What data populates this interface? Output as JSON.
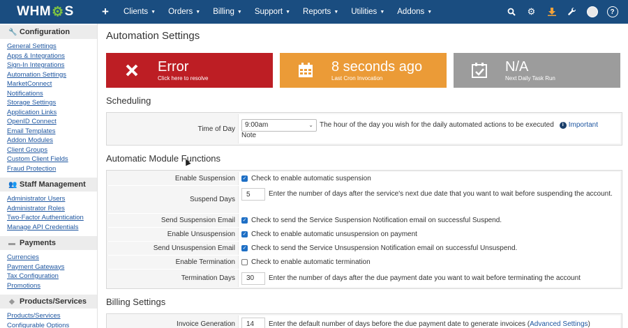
{
  "logo": {
    "left": "WHM",
    "gear": "⚙",
    "right": "S"
  },
  "nav": {
    "items": [
      {
        "label": "Clients"
      },
      {
        "label": "Orders"
      },
      {
        "label": "Billing"
      },
      {
        "label": "Support"
      },
      {
        "label": "Reports"
      },
      {
        "label": "Utilities"
      },
      {
        "label": "Addons"
      }
    ],
    "icons": [
      "search-icon",
      "gears-icon",
      "download-icon",
      "wrench-icon",
      "avatar",
      "help-icon"
    ]
  },
  "sidebar": {
    "sections": [
      {
        "title": "Configuration",
        "icon": "wrench-icon",
        "links": [
          "General Settings",
          "Apps & Integrations",
          "Sign-In Integrations",
          "Automation Settings",
          "MarketConnect",
          "Notifications",
          "Storage Settings",
          "Application Links",
          "OpenID Connect",
          "Email Templates",
          "Addon Modules",
          "Client Groups",
          "Custom Client Fields",
          "Fraud Protection"
        ]
      },
      {
        "title": "Staff Management",
        "icon": "users-icon",
        "links": [
          "Administrator Users",
          "Administrator Roles",
          "Two-Factor Authentication",
          "Manage API Credentials"
        ]
      },
      {
        "title": "Payments",
        "icon": "card-icon",
        "links": [
          "Currencies",
          "Payment Gateways",
          "Tax Configuration",
          "Promotions"
        ]
      },
      {
        "title": "Products/Services",
        "icon": "cube-icon",
        "links": [
          "Products/Services",
          "Configurable Options"
        ]
      }
    ]
  },
  "page": {
    "title": "Automation Settings"
  },
  "stats": [
    {
      "big": "Error",
      "small": "Click here to resolve",
      "icon": "x-icon",
      "color": "#bd1e24"
    },
    {
      "big": "8 seconds ago",
      "small": "Last Cron Invocation",
      "icon": "calendar-icon",
      "color": "#eb9b37"
    },
    {
      "big": "N/A",
      "small": "Next Daily Task Run",
      "icon": "calendar-check-icon",
      "color": "#9c9c9c"
    }
  ],
  "scheduling": {
    "title": "Scheduling",
    "time_label": "Time of Day",
    "time_value": "9:00am",
    "time_desc": "The hour of the day you wish for the daily automated actions to be executed",
    "important": "Important",
    "note": "Note"
  },
  "modules": {
    "title": "Automatic Module Functions",
    "rows": {
      "enable_suspension": {
        "label": "Enable Suspension",
        "checked": true,
        "text": "Check to enable automatic suspension"
      },
      "suspend_days": {
        "label": "Suspend Days",
        "value": "5",
        "text": "Enter the number of days after the service's next due date that you want to wait before suspending the account."
      },
      "send_suspension": {
        "label": "Send Suspension Email",
        "checked": true,
        "text": "Check to send the Service Suspension Notification email on successful Suspend."
      },
      "enable_unsuspension": {
        "label": "Enable Unsuspension",
        "checked": true,
        "text": "Check to enable automatic unsuspension on payment"
      },
      "send_unsuspension": {
        "label": "Send Unsuspension Email",
        "checked": true,
        "text": "Check to send the Service Unsuspension Notification email on successful Unsuspend."
      },
      "enable_termination": {
        "label": "Enable Termination",
        "checked": false,
        "text": "Check to enable automatic termination"
      },
      "termination_days": {
        "label": "Termination Days",
        "value": "30",
        "text": "Enter the number of days after the due payment date you want to wait before terminating the account"
      }
    }
  },
  "billing": {
    "title": "Billing Settings",
    "invoice_label": "Invoice Generation",
    "invoice_value": "14",
    "invoice_text": "Enter the default number of days before the due payment date to generate invoices (",
    "advanced_link": "Advanced Settings",
    "invoice_close": ")"
  }
}
